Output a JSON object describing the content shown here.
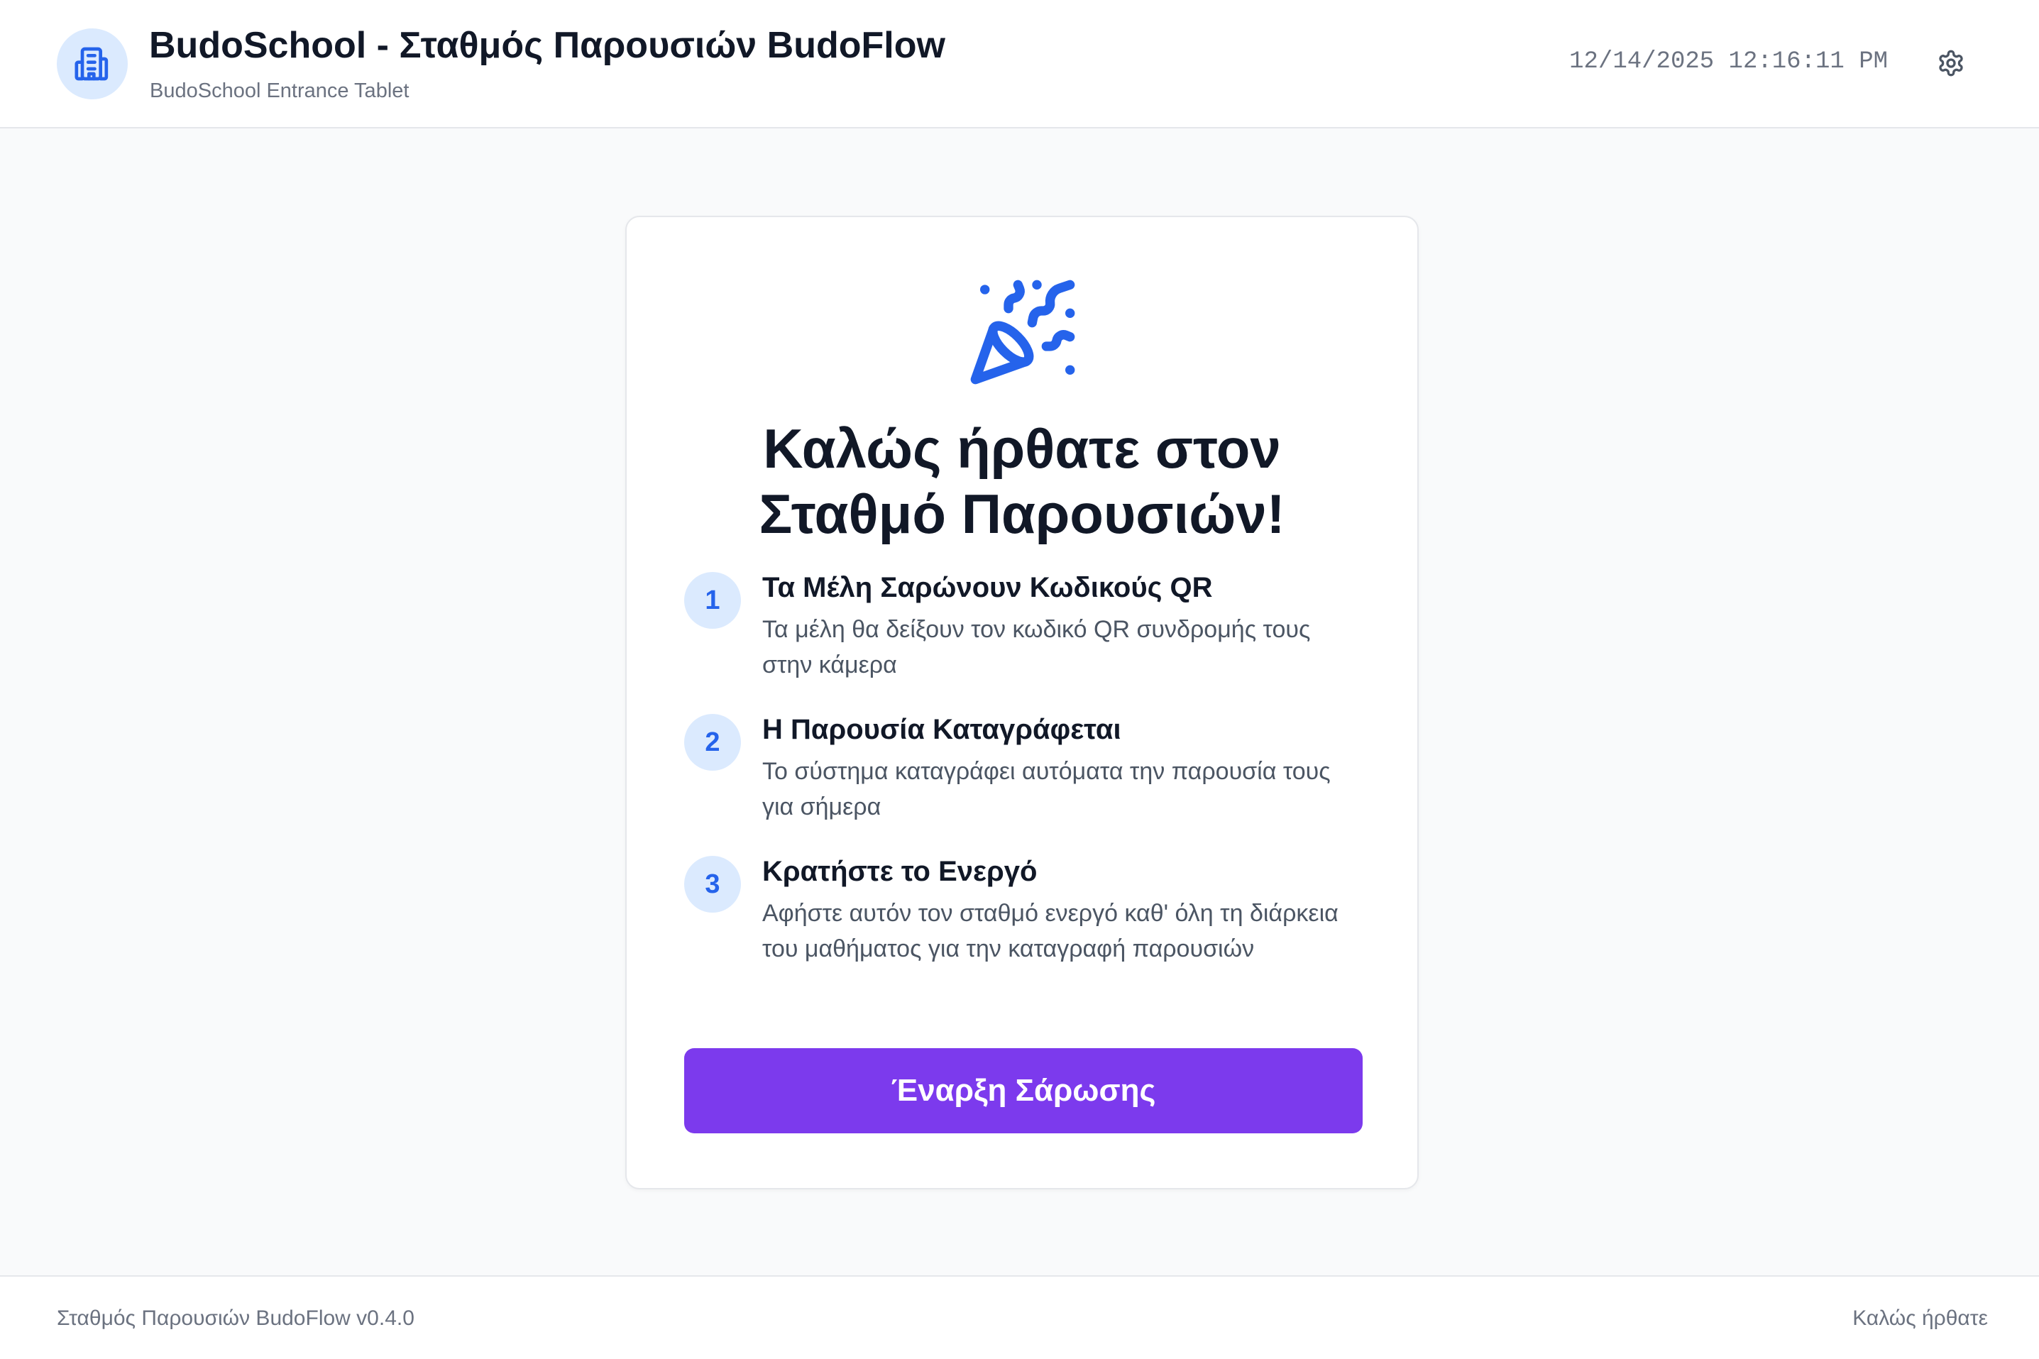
{
  "header": {
    "title": "BudoSchool - Σταθμός Παρουσιών BudoFlow",
    "subtitle": "BudoSchool Entrance Tablet",
    "datetime": "12/14/2025 12:16:11 PM",
    "logo_icon": "building-icon",
    "settings_icon": "gear-icon"
  },
  "welcome": {
    "icon": "party-popper-icon",
    "title_line1": "Καλώς ήρθατε στον",
    "title_line2": "Σταθμό Παρουσιών!"
  },
  "steps": [
    {
      "number": "1",
      "title": "Τα Μέλη Σαρώνουν Κωδικούς QR",
      "description": "Τα μέλη θα δείξουν τον κωδικό QR συνδρομής τους στην κάμερα"
    },
    {
      "number": "2",
      "title": "Η Παρουσία Καταγράφεται",
      "description": "Το σύστημα καταγράφει αυτόματα την παρουσία τους για σήμερα"
    },
    {
      "number": "3",
      "title": "Κρατήστε το Ενεργό",
      "description": "Αφήστε αυτόν τον σταθμό ενεργό καθ' όλη τη διάρκεια του μαθήματος για την καταγραφή παρουσιών"
    }
  ],
  "start_button": {
    "label": "Έναρξη Σάρωσης"
  },
  "footer": {
    "version": "Σταθμός Παρουσιών BudoFlow v0.4.0",
    "status": "Καλώς ήρθατε"
  },
  "colors": {
    "accent_blue": "#2563eb",
    "accent_blue_light": "#dbeafe",
    "button_purple": "#7c3aed",
    "text_dark": "#111827",
    "text_muted": "#6b7280",
    "background": "#f9fafb"
  }
}
